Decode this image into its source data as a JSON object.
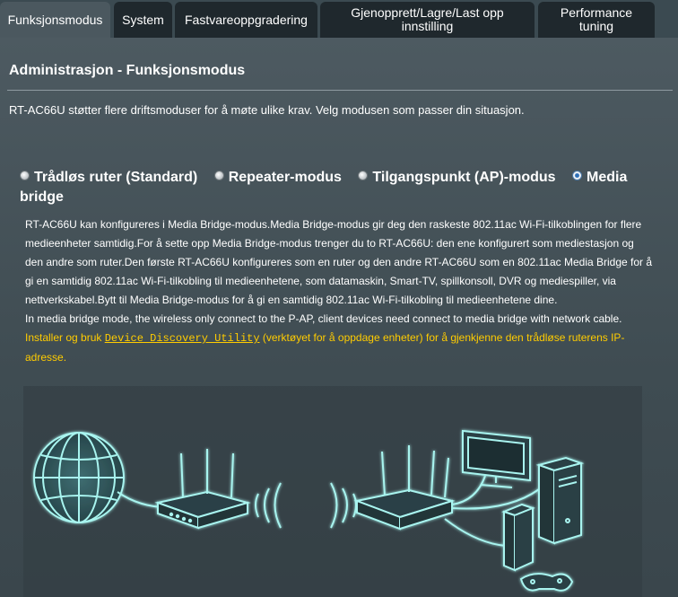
{
  "tabs": [
    {
      "label": "Funksjonsmodus",
      "active": true
    },
    {
      "label": "System",
      "active": false
    },
    {
      "label": "Fastvareoppgradering",
      "active": false
    },
    {
      "label": "Gjenopprett/Lagre/Last opp innstilling",
      "active": false
    },
    {
      "label": "Performance tuning",
      "active": false
    }
  ],
  "page": {
    "title": "Administrasjon - Funksjonsmodus",
    "subtitle": "RT-AC66U støtter flere driftsmoduser for å møte ulike krav. Velg modusen som passer din situasjon."
  },
  "modes": [
    {
      "label": "Trådløs ruter (Standard)",
      "checked": false
    },
    {
      "label": "Repeater-modus",
      "checked": false
    },
    {
      "label": "Tilgangspunkt (AP)-modus",
      "checked": false
    },
    {
      "label": "Media bridge",
      "checked": true
    }
  ],
  "description": {
    "main": "RT-AC66U kan konfigureres i Media Bridge-modus.Media Bridge-modus gir deg den raskeste 802.11ac Wi-Fi-tilkoblingen for flere medieenheter samtidig.For å sette opp Media Bridge-modus trenger du to RT-AC66U: den ene konfigurert som mediestasjon og den andre som ruter.Den første RT-AC66U konfigureres som en ruter og den andre RT-AC66U som en 802.11ac Media Bridge for å gi en samtidig 802.11ac Wi-Fi-tilkobling til medieenhetene, som datamaskin, Smart-TV, spillkonsoll, DVR og mediespiller, via nettverkskabel.Bytt til Media Bridge-modus for å gi en samtidig 802.11ac Wi-Fi-tilkobling til medieenhetene dine.",
    "english": "In media bridge mode, the wireless only connect to the P-AP, client devices need connect to media bridge with network cable.",
    "link_prefix": "Installer og bruk ",
    "link_text": "Device Discovery Utility",
    "link_suffix": " (verktøyet for å oppdage enheter) for å gjenkjenne den trådløse ruterens IP-adresse."
  },
  "colors": {
    "accent_link": "#ffcc00",
    "glow": "#9ff3f0",
    "panel_bg": "#4b585f",
    "tab_bg": "#1f282d"
  }
}
